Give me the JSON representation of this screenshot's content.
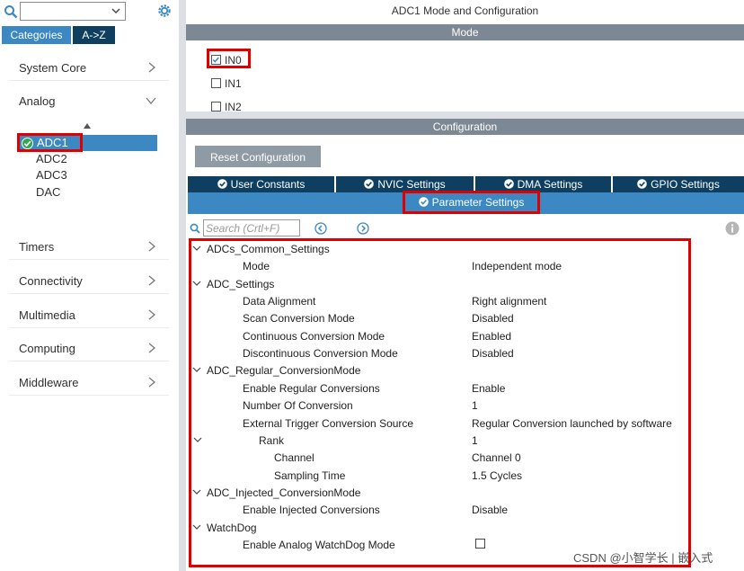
{
  "left_panel": {
    "search_placeholder": "",
    "tabs": {
      "categories": "Categories",
      "az": "A->Z"
    },
    "categories": [
      {
        "label": "System Core",
        "expanded": false
      },
      {
        "label": "Analog",
        "expanded": true
      },
      {
        "label": "Timers",
        "expanded": false
      },
      {
        "label": "Connectivity",
        "expanded": false
      },
      {
        "label": "Multimedia",
        "expanded": false
      },
      {
        "label": "Computing",
        "expanded": false
      },
      {
        "label": "Middleware",
        "expanded": false
      }
    ],
    "analog_items": [
      "ADC1",
      "ADC2",
      "ADC3",
      "DAC"
    ],
    "selected_item": "ADC1"
  },
  "right_panel": {
    "title": "ADC1 Mode and Configuration",
    "mode_header": "Mode",
    "mode_inputs": [
      {
        "label": "IN0",
        "checked": true
      },
      {
        "label": "IN1",
        "checked": false
      },
      {
        "label": "IN2",
        "checked": false
      }
    ],
    "config_header": "Configuration",
    "reset_button": "Reset Configuration",
    "config_tabs": [
      "User Constants",
      "NVIC Settings",
      "DMA Settings",
      "GPIO Settings"
    ],
    "active_tab": "Parameter Settings",
    "search_placeholder": "Search (Crtl+F)",
    "parameters": [
      {
        "type": "group",
        "name": "ADCs_Common_Settings"
      },
      {
        "type": "param",
        "name": "Mode",
        "value": "Independent mode"
      },
      {
        "type": "group",
        "name": "ADC_Settings"
      },
      {
        "type": "param",
        "name": "Data Alignment",
        "value": "Right alignment"
      },
      {
        "type": "param",
        "name": "Scan Conversion Mode",
        "value": "Disabled"
      },
      {
        "type": "param",
        "name": "Continuous Conversion Mode",
        "value": "Enabled"
      },
      {
        "type": "param",
        "name": "Discontinuous Conversion Mode",
        "value": "Disabled"
      },
      {
        "type": "group",
        "name": "ADC_Regular_ConversionMode"
      },
      {
        "type": "param",
        "name": "Enable Regular Conversions",
        "value": "Enable"
      },
      {
        "type": "param",
        "name": "Number Of Conversion",
        "value": "1"
      },
      {
        "type": "param",
        "name": "External Trigger Conversion Source",
        "value": "Regular Conversion launched by software"
      },
      {
        "type": "subgroup",
        "name": "Rank",
        "value": "1"
      },
      {
        "type": "subparam",
        "name": "Channel",
        "value": "Channel 0"
      },
      {
        "type": "subparam",
        "name": "Sampling Time",
        "value": "1.5 Cycles"
      },
      {
        "type": "group",
        "name": "ADC_Injected_ConversionMode"
      },
      {
        "type": "param",
        "name": "Enable Injected Conversions",
        "value": "Disable"
      },
      {
        "type": "group",
        "name": "WatchDog"
      },
      {
        "type": "checkbox",
        "name": "Enable Analog WatchDog Mode",
        "checked": false
      }
    ]
  },
  "watermark": "CSDN @小智学长 | 嵌入式",
  "colors": {
    "accent_blue": "#3b88c3",
    "dark_navy": "#0e3f61",
    "header_grey": "#7c8893",
    "highlight_red": "#e00000"
  }
}
